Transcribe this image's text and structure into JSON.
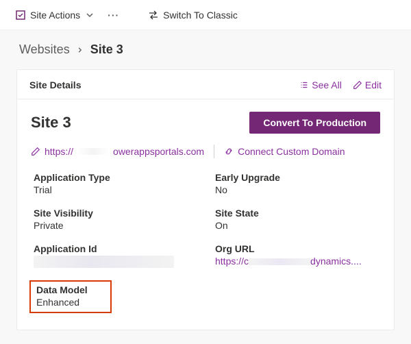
{
  "topbar": {
    "site_actions_label": "Site Actions",
    "more_label": "···",
    "switch_label": "Switch To Classic"
  },
  "breadcrumb": {
    "parent": "Websites",
    "current": "Site 3"
  },
  "card": {
    "title": "Site Details",
    "see_all_label": "See All",
    "edit_label": "Edit"
  },
  "site": {
    "name": "Site 3",
    "convert_label": "Convert To Production",
    "url_prefix": "https://",
    "url_suffix": "owerappsportals.com",
    "connect_domain_label": "Connect Custom Domain"
  },
  "fields": {
    "app_type": {
      "label": "Application Type",
      "value": "Trial"
    },
    "early_upgrade": {
      "label": "Early Upgrade",
      "value": "No"
    },
    "visibility": {
      "label": "Site Visibility",
      "value": "Private"
    },
    "site_state": {
      "label": "Site State",
      "value": "On"
    },
    "app_id": {
      "label": "Application Id",
      "value": ""
    },
    "org_url": {
      "label": "Org URL",
      "value_prefix": "https://c",
      "value_suffix": "dynamics...."
    },
    "data_model": {
      "label": "Data Model",
      "value": "Enhanced"
    }
  }
}
